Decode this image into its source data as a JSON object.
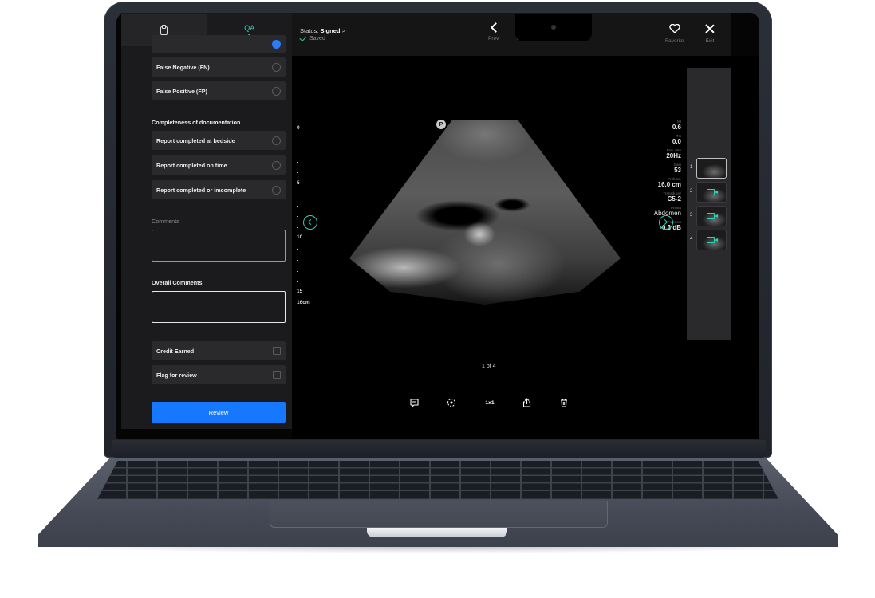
{
  "tabs": {
    "notes_icon": "clipboard-icon",
    "qa_label": "QA"
  },
  "interpretation_options": [
    {
      "label": "False Negative (FN)",
      "selected": false
    },
    {
      "label": "False Positive (FP)",
      "selected": false
    }
  ],
  "completeness": {
    "title": "Completeness of documentation",
    "options": [
      {
        "label": "Report completed at bedside",
        "selected": false
      },
      {
        "label": "Report completed on time",
        "selected": false
      },
      {
        "label": "Report completed or imcomplete",
        "selected": false
      }
    ]
  },
  "comments": {
    "label": "Comments",
    "value": ""
  },
  "overall_comments": {
    "label": "Overall Comments",
    "value": ""
  },
  "checks": [
    {
      "label": "Credit Earned",
      "checked": false
    },
    {
      "label": "Flag for review",
      "checked": false
    }
  ],
  "review_button": "Review",
  "header": {
    "status_prefix": "Status:",
    "status_value": "Signed",
    "status_chevron": ">",
    "saved": "Saved",
    "prev": "Prev.",
    "next": "Next",
    "favorite": "Favorite",
    "exit": "Exit"
  },
  "depth_scale": {
    "marks": [
      "0",
      "5",
      "10",
      "15"
    ],
    "max": "16cm"
  },
  "probe_marker": "P",
  "parameters": [
    {
      "key": "MI",
      "value": "0.6"
    },
    {
      "key": "TIs",
      "value": "0.0"
    },
    {
      "key": "Frm. rate",
      "value": "20Hz"
    },
    {
      "key": "Gain",
      "value": "53"
    },
    {
      "key": "Profund.",
      "value": "16.0 cm"
    },
    {
      "key": "Transducer",
      "value": "C5-2"
    },
    {
      "key": "Preset",
      "value": "Abdomen"
    },
    {
      "key": "Potencia",
      "value": "-0.3 dB"
    }
  ],
  "thumbnails": [
    "1",
    "2",
    "3",
    "4"
  ],
  "page_indicator": "1 of 4",
  "toolbar": {
    "layout_label": "1x1"
  },
  "colors": {
    "accent": "#29d4b8",
    "primary_button": "#1677ff"
  }
}
